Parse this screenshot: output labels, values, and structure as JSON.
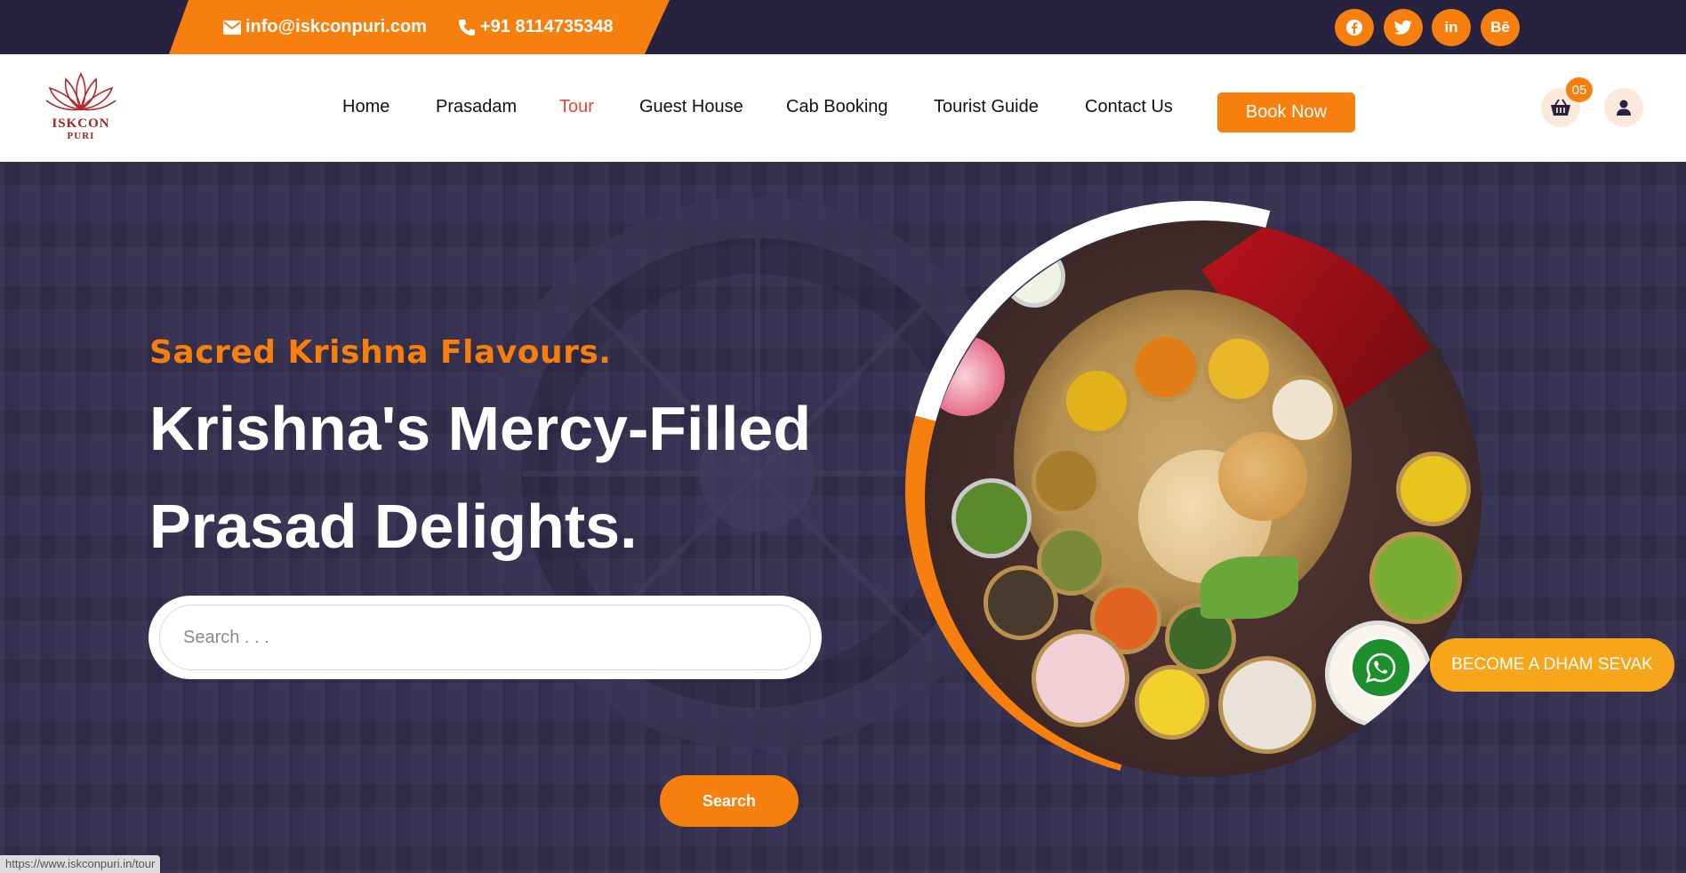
{
  "topbar": {
    "email": "info@iskconpuri.com",
    "phone": "+91 8114735348",
    "social": [
      "facebook-icon",
      "twitter-icon",
      "linkedin-icon",
      "behance-icon"
    ],
    "social_labels": {
      "behance": "Bē",
      "linkedin": "in"
    }
  },
  "brand": {
    "logo_line1": "ISKCON",
    "logo_line2": "PURI"
  },
  "nav": {
    "items": [
      {
        "label": "Home"
      },
      {
        "label": "Prasadam"
      },
      {
        "label": "Tour",
        "active": true
      },
      {
        "label": "Guest House"
      },
      {
        "label": "Cab Booking"
      },
      {
        "label": "Tourist Guide"
      },
      {
        "label": "Contact Us"
      }
    ],
    "book_now": "Book Now",
    "cart_count": "05"
  },
  "hero": {
    "tagline": "Sacred Krishna Flavours.",
    "headline_line1": "Krishna's Mercy-Filled",
    "headline_line2": "Prasad Delights.",
    "search_placeholder": "Search . . .",
    "search_button": "Search"
  },
  "floating": {
    "become_dham_sevak": "BECOME A DHAM SEVAK"
  },
  "status_bar": {
    "url": "https://www.iskconpuri.in/tour"
  },
  "colors": {
    "accent": "#f77f0e",
    "topbar": "#262240",
    "hero_bg": "#332e4e",
    "whatsapp": "#1d8f2c",
    "dham_button": "#f7a61c"
  }
}
